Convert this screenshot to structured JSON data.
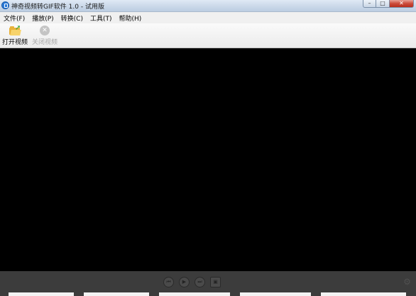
{
  "window": {
    "title": "神奇视频转GIF软件 1.0 - 试用版"
  },
  "window_controls": {
    "minimize": "–",
    "maximize": "□",
    "close": "✕"
  },
  "menu": [
    "文件(F)",
    "播放(P)",
    "转换(C)",
    "工具(T)",
    "帮助(H)"
  ],
  "toolbar": {
    "open_video_label": "打开视频",
    "close_video_label": "关闭视频"
  },
  "icons": {
    "app": "app-icon",
    "open_video": "folder-open-icon",
    "close_video": "close-circle-icon",
    "prev": "previous-icon",
    "play": "play-icon",
    "next": "next-icon",
    "snapshot": "snapshot-icon",
    "settings": "gear-icon"
  },
  "colors": {
    "video_background": "#000000",
    "control_bar": "#3c3c3c",
    "close_button": "#c94634"
  }
}
